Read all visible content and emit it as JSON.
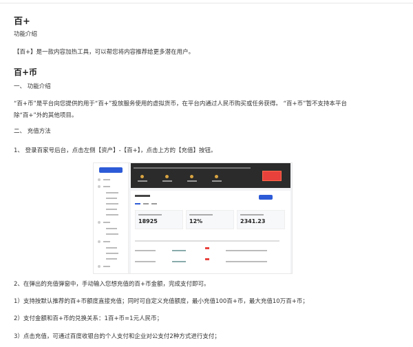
{
  "title": "百+",
  "intro_label": "功能介绍",
  "intro_text": "【百+】是一款内容加热工具，可以帮您将内容推荐给更多潜在用户。",
  "coin_title": "百+币",
  "sec1_title": "一、 功能介绍",
  "sec1_line1": "“百+币”是平台向您提供的用于“百+”投放服务使用的虚拟货币，在平台内通过人民币购买或任务获得。 “百+币”暂不支持本平台",
  "sec1_line2": "除“百+”外的其他项目。",
  "sec2_title": "二、 充值方法",
  "step1": "1、 登录百家号后台，点击左侧【资产】-【百+】，点击上方的【充值】按钮。",
  "step2": "2、在弹出的充值弹窗中，手动输入您想充值的百+币金额，完成支付即可。",
  "note1": "1）支持按默认推荐的百+币额度直接充值；同时可自定义充值额度，最小充值100百+币，最大充值10万百+币；",
  "note2": "2）支付金额和百+币的兑换关系：1百+币=1元人民币；",
  "note3": "3）点击充值，可通过百度收银台的个人支付和企业对公支付2种方式进行支付；",
  "screenshot": {
    "card_values": [
      "18925",
      "12%",
      "2341.23"
    ]
  }
}
